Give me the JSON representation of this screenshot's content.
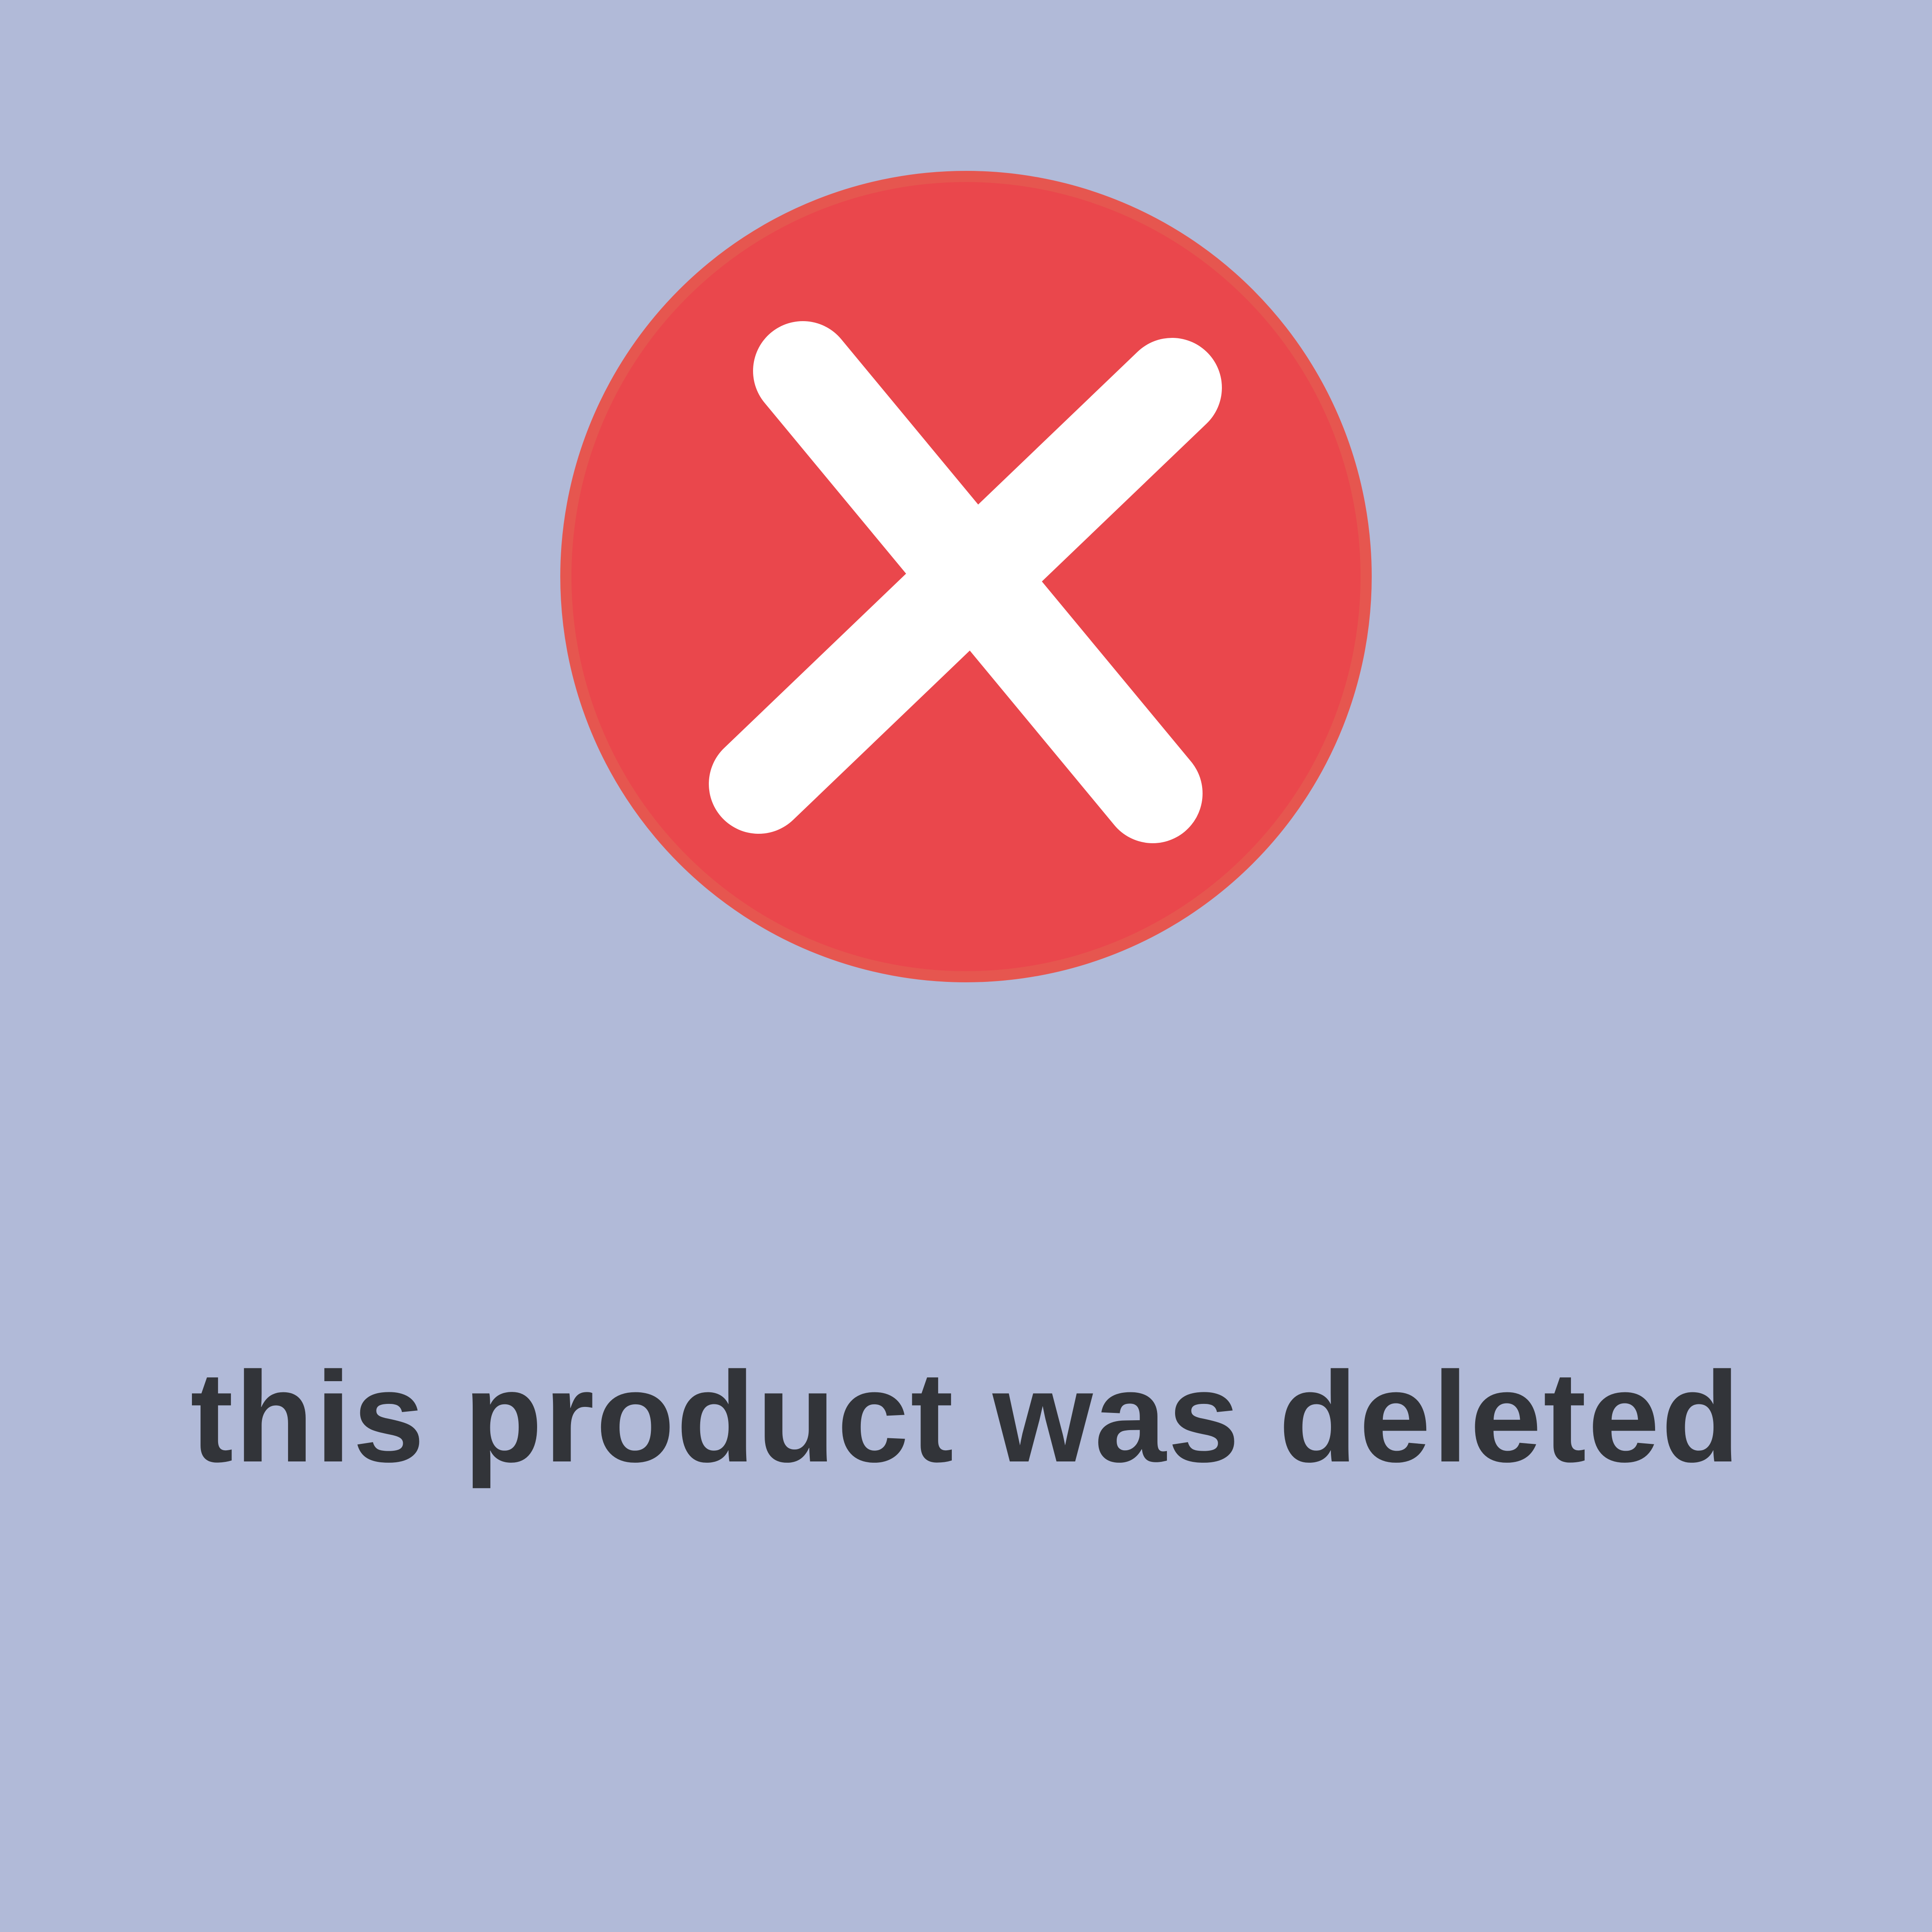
{
  "page": {
    "background_color": "#b1bad8"
  },
  "error_badge": {
    "icon": "close-x-icon",
    "circle_color": "#ea474c",
    "circle_border_color": "#e6564f",
    "mark_color": "#ffffff"
  },
  "message": {
    "text": "this product was deleted",
    "color": "#323439"
  }
}
